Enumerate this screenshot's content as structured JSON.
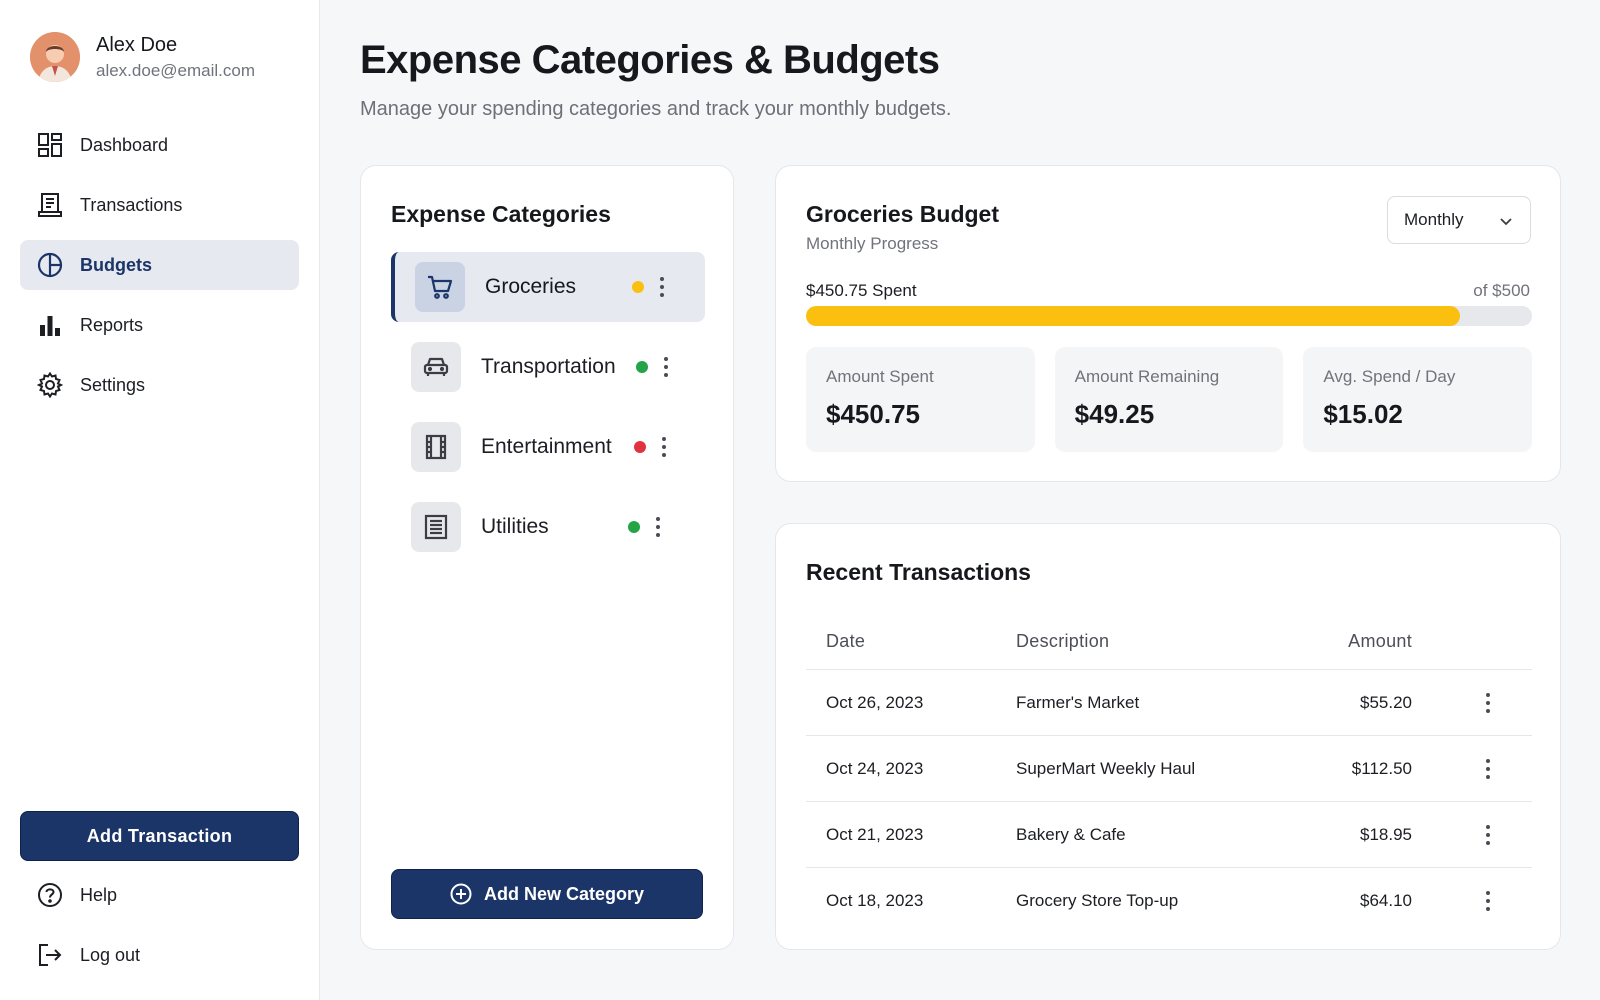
{
  "user": {
    "name": "Alex Doe",
    "email": "alex.doe@email.com"
  },
  "nav": [
    {
      "label": "Dashboard",
      "icon": "dashboard-icon",
      "active": false
    },
    {
      "label": "Transactions",
      "icon": "receipt-icon",
      "active": false
    },
    {
      "label": "Budgets",
      "icon": "pie-chart-icon",
      "active": true
    },
    {
      "label": "Reports",
      "icon": "bar-chart-icon",
      "active": false
    },
    {
      "label": "Settings",
      "icon": "gear-icon",
      "active": false
    }
  ],
  "add_transaction_label": "Add Transaction",
  "bottom_nav": [
    {
      "label": "Help",
      "icon": "help-icon"
    },
    {
      "label": "Log out",
      "icon": "logout-icon"
    }
  ],
  "page": {
    "title": "Expense Categories & Budgets",
    "subtitle": "Manage your spending categories and track your monthly budgets."
  },
  "categories": {
    "title": "Expense Categories",
    "items": [
      {
        "name": "Groceries",
        "icon": "cart-icon",
        "status_color": "#fbbf0f",
        "active": true
      },
      {
        "name": "Transportation",
        "icon": "car-icon",
        "status_color": "#22a447",
        "active": false
      },
      {
        "name": "Entertainment",
        "icon": "film-icon",
        "status_color": "#e0323f",
        "active": false
      },
      {
        "name": "Utilities",
        "icon": "bill-icon",
        "status_color": "#22a447",
        "active": false
      }
    ],
    "add_label": "Add New Category"
  },
  "budget": {
    "title": "Groceries Budget",
    "subtitle": "Monthly Progress",
    "period": "Monthly",
    "spent_label": "$450.75 Spent",
    "of_label": "of $500",
    "progress_fraction": 0.9015,
    "progress_color": "#fbbf0f",
    "stats": [
      {
        "label": "Amount Spent",
        "value": "$450.75"
      },
      {
        "label": "Amount Remaining",
        "value": "$49.25"
      },
      {
        "label": "Avg. Spend / Day",
        "value": "$15.02"
      }
    ]
  },
  "transactions": {
    "title": "Recent Transactions",
    "columns": {
      "date": "Date",
      "description": "Description",
      "amount": "Amount"
    },
    "rows": [
      {
        "date": "Oct 26, 2023",
        "description": "Farmer's Market",
        "amount": "$55.20"
      },
      {
        "date": "Oct 24, 2023",
        "description": "SuperMart Weekly Haul",
        "amount": "$112.50"
      },
      {
        "date": "Oct 21, 2023",
        "description": "Bakery & Cafe",
        "amount": "$18.95"
      },
      {
        "date": "Oct 18, 2023",
        "description": "Grocery Store Top-up",
        "amount": "$64.10"
      }
    ]
  },
  "colors": {
    "brand": "#1b3568",
    "accent_yellow": "#fbbf0f",
    "green": "#22a447",
    "red": "#e0323f"
  }
}
